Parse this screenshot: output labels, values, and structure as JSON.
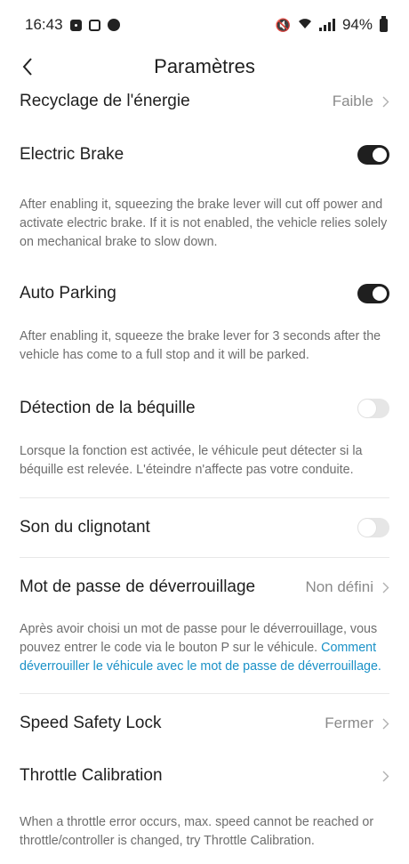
{
  "status_bar": {
    "time": "16:43",
    "battery_text": "94%"
  },
  "header": {
    "title": "Paramètres"
  },
  "settings": {
    "energy_recycling": {
      "label": "Recyclage de l'énergie",
      "value": "Faible"
    },
    "electric_brake": {
      "label": "Electric Brake",
      "enabled": true,
      "description": "After enabling it, squeezing the brake lever will cut off power and activate electric brake. If it is not enabled, the vehicle relies solely on mechanical brake to slow down."
    },
    "auto_parking": {
      "label": "Auto Parking",
      "enabled": true,
      "description": "After enabling it, squeeze the brake lever for 3 seconds after the vehicle has come to a full stop and it will be parked."
    },
    "kickstand_detection": {
      "label": "Détection de la béquille",
      "enabled": false,
      "description": "Lorsque la fonction est activée, le véhicule peut détecter si la béquille est relevée. L'éteindre n'affecte pas votre conduite."
    },
    "turn_signal_sound": {
      "label": "Son du clignotant",
      "enabled": false
    },
    "unlock_password": {
      "label": "Mot de passe de déverrouillage",
      "value": "Non défini",
      "description": "Après avoir choisi un mot de passe pour le déverrouillage, vous pouvez entrer le code via le bouton P sur le véhicule.",
      "link": "Comment déverrouiller le véhicule avec le mot de passe de déverrouillage."
    },
    "speed_safety_lock": {
      "label": "Speed Safety Lock",
      "value": "Fermer"
    },
    "throttle_calibration": {
      "label": "Throttle Calibration",
      "description": "When a throttle error occurs, max. speed cannot be reached or throttle/controller is changed, try Throttle Calibration."
    }
  },
  "colors": {
    "accent_link": "#1a91c7",
    "toggle_on": "#1f1f1f",
    "toggle_off": "#e6e6e6"
  }
}
